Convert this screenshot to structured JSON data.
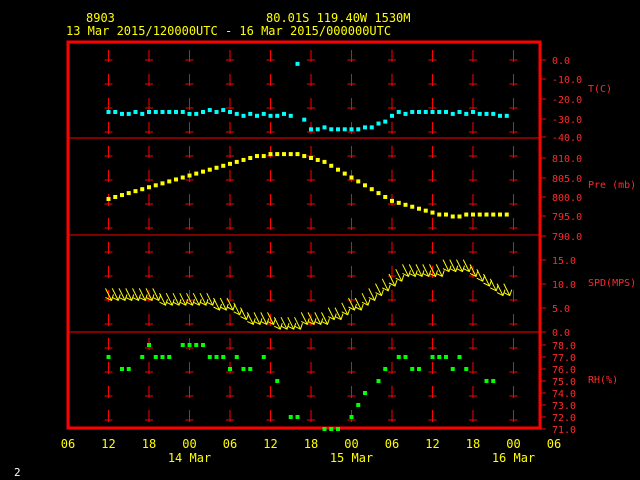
{
  "header": {
    "station": "8903",
    "location": "80.01S  119.40W  1530M",
    "time_range": "13 Mar 2015/120000UTC - 16 Mar 2015/000000UTC"
  },
  "page_number": "2",
  "colors": {
    "background": "#000000",
    "frame": "#ff0000",
    "text": "#ffff00",
    "temp": "#00ffff",
    "pressure": "#ffff00",
    "wind": "#ffff00",
    "rh": "#00ff00"
  },
  "chart_data": [
    {
      "type": "scatter",
      "ylabel": "T(C)",
      "ylim": [
        -40,
        0
      ],
      "ytick_labels": [
        "0.0",
        "-10.0",
        "-20.0",
        "-30.0",
        "-40.0"
      ],
      "x": [
        12,
        13,
        14,
        15,
        16,
        17,
        18,
        19,
        20,
        21,
        22,
        23,
        0,
        1,
        2,
        3,
        4,
        5,
        6,
        7,
        8,
        9,
        10,
        11,
        12,
        13,
        14,
        15,
        16,
        17,
        18,
        19,
        20,
        21,
        22,
        23,
        0,
        1,
        2,
        3,
        4,
        5,
        6,
        7,
        8,
        9,
        10,
        11,
        12,
        13,
        14,
        15,
        16,
        17,
        18,
        19,
        20,
        21,
        22,
        23
      ],
      "t": [
        0,
        1,
        2,
        3,
        4,
        5,
        6,
        7,
        8,
        9,
        10,
        11,
        12,
        13,
        14,
        15,
        16,
        17,
        18,
        19,
        20,
        21,
        22,
        23,
        24,
        25,
        26,
        27,
        28,
        29,
        30,
        31,
        32,
        33,
        34,
        35,
        36,
        37,
        38,
        39,
        40,
        41,
        42,
        43,
        44,
        45,
        46,
        47,
        48,
        49,
        50,
        51,
        52,
        53,
        54,
        55,
        56,
        57,
        58,
        59
      ],
      "values": [
        -27,
        -27,
        -28,
        -28,
        -27,
        -28,
        -27,
        -27,
        -27,
        -27,
        -27,
        -27,
        -28,
        -28,
        -27,
        -26,
        -27,
        -26,
        -27,
        -28,
        -29,
        -28,
        -29,
        -28,
        -29,
        -29,
        -28,
        -29,
        -2,
        -31,
        -36,
        -36,
        -35,
        -36,
        -36,
        -36,
        -36,
        -36,
        -35,
        -35,
        -33,
        -32,
        -29,
        -27,
        -28,
        -27,
        -27,
        -27,
        -27,
        -27,
        -27,
        -28,
        -27,
        -28,
        -27,
        -28,
        -28,
        -28,
        -29,
        -29
      ]
    },
    {
      "type": "scatter",
      "ylabel": "Pre (mb)",
      "ylim": [
        790,
        813
      ],
      "ytick_labels": [
        "810.0",
        "805.0",
        "800.0",
        "795.0",
        "790.0"
      ],
      "values": [
        799.5,
        800,
        800.5,
        801,
        801.5,
        802,
        802.5,
        803,
        803.5,
        804,
        804.5,
        805,
        805.5,
        806,
        806.5,
        807,
        807.5,
        808,
        808.5,
        809,
        809.5,
        810,
        810.5,
        810.5,
        811,
        811,
        811,
        811,
        811,
        810.5,
        810,
        809.5,
        809,
        808,
        807,
        806,
        805,
        804,
        803,
        802,
        801,
        800,
        799,
        798.5,
        798,
        797.5,
        797,
        796.5,
        796,
        795.5,
        795.5,
        795,
        795,
        795.5,
        795.5,
        795.5,
        795.5,
        795.5,
        795.5,
        795.5
      ]
    },
    {
      "type": "wind_barbs",
      "ylabel": "SPD(MPS)",
      "ylim": [
        0,
        18
      ],
      "ytick_labels": [
        "15.0",
        "10.0",
        "5.0",
        "0.0"
      ],
      "values": [
        7,
        7,
        7,
        7,
        7,
        7,
        7,
        7,
        6,
        6,
        6,
        6,
        6,
        6,
        6,
        6,
        5,
        5,
        5,
        4,
        3,
        2,
        2,
        2,
        2,
        1,
        1,
        1,
        1,
        2,
        2,
        2,
        2,
        3,
        3,
        4,
        5,
        5,
        6,
        7,
        8,
        9,
        10,
        11,
        12,
        12,
        12,
        12,
        12,
        12,
        13,
        13,
        13,
        13,
        12,
        11,
        10,
        9,
        8,
        8
      ]
    },
    {
      "type": "scatter",
      "ylabel": "RH(%)",
      "ylim": [
        71,
        78
      ],
      "ytick_labels": [
        "78.0",
        "77.0",
        "76.0",
        "75.0",
        "74.0",
        "73.0",
        "72.0",
        "71.0"
      ],
      "values": [
        77,
        null,
        76,
        76,
        null,
        77,
        78,
        77,
        77,
        77,
        null,
        78,
        78,
        78,
        78,
        77,
        77,
        77,
        76,
        77,
        76,
        76,
        null,
        77,
        null,
        75,
        null,
        72,
        72,
        null,
        null,
        null,
        71,
        71,
        71,
        null,
        72,
        73,
        74,
        null,
        75,
        76,
        null,
        77,
        77,
        76,
        76,
        null,
        77,
        77,
        77,
        76,
        77,
        76,
        null,
        null,
        75,
        75,
        null,
        null
      ]
    }
  ],
  "x_axis": {
    "tick_labels": [
      "06",
      "12",
      "18",
      "00",
      "06",
      "12",
      "18",
      "00",
      "06",
      "12",
      "18",
      "00",
      "06"
    ],
    "day_labels": [
      "14 Mar",
      "15 Mar",
      "16 Mar"
    ]
  }
}
